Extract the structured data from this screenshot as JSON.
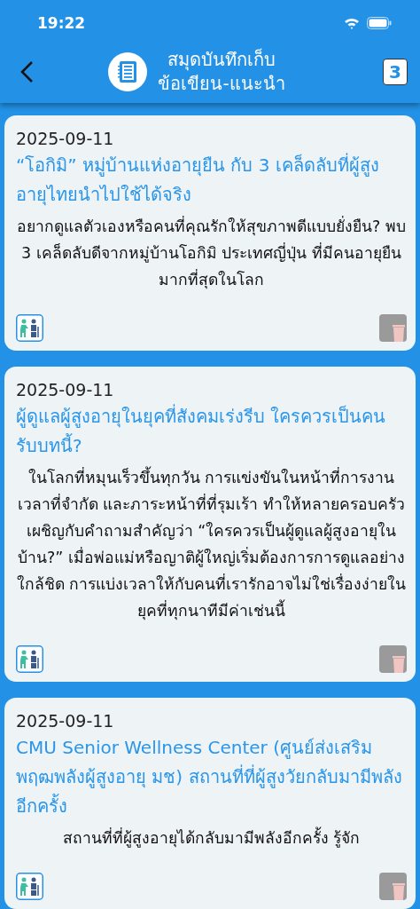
{
  "status_bar": {
    "time": "19:22"
  },
  "header": {
    "title_lines": [
      "สมุดบันทึกเก็บ",
      "ข้อเขียน-แนะนำ"
    ],
    "count": "3"
  },
  "articles": [
    {
      "date": "2025-09-11",
      "title": "“โอกิมิ” หมู่บ้านแห่งอายุยืน กับ 3 เคล็ดลับที่ผู้สูงอายุไทยนำไปใช้ได้จริง",
      "excerpt": "อยากดูแลตัวเองหรือคนที่คุณรักให้สุขภาพดีแบบยั่งยืน? พบ 3 เคล็ดลับดีจากหมู่บ้านโอกิมิ ประเทศญี่ปุ่น ที่มีคนอายุยืนมากที่สุดในโลก"
    },
    {
      "date": "2025-09-11",
      "title": "ผู้ดูแลผู้สูงอายุในยุคที่สังคมเร่งรีบ ใครควรเป็นคนรับบทนี้?",
      "excerpt": "ในโลกที่หมุนเร็วขึ้นทุกวัน การแข่งขันในหน้าที่การงาน เวลาที่จำกัด และภาระหน้าที่ที่รุมเร้า ทำให้หลายครอบครัวเผชิญกับคำถามสำคัญว่า “ใครควรเป็นผู้ดูแลผู้สูงอายุในบ้าน?” เมื่อพ่อแม่หรือญาติผู้ใหญ่เริ่มต้องการการดูแลอย่างใกล้ชิด การแบ่งเวลาให้กับคนที่เรารักอาจไม่ใช่เรื่องง่ายในยุคที่ทุกนาทีมีค่าเช่นนี้"
    },
    {
      "date": "2025-09-11",
      "title": "CMU Senior Wellness Center (ศูนย์ส่งเสริมพฤฒพลังผู้สูงอายุ มช) สถานที่ที่ผู้สูงวัยกลับมามีพลังอีกครั้ง",
      "excerpt": "สถานที่ที่ผู้สูงอายุได้กลับมามีพลังอีกครั้ง รู้จัก"
    }
  ]
}
